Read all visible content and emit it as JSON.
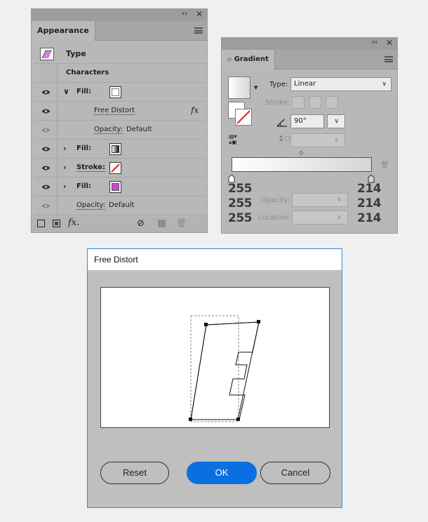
{
  "appearance": {
    "tab_label": "Appearance",
    "header_label": "Type",
    "characters_label": "Characters",
    "rows": [
      {
        "label": "Fill:"
      },
      {
        "label": "Free Distort",
        "fx": "fx"
      },
      {
        "label": "Opacity:",
        "value": "Default"
      },
      {
        "label": "Fill:"
      },
      {
        "label": "Stroke:"
      },
      {
        "label": "Fill:"
      },
      {
        "label": "Opacity:",
        "value": "Default"
      }
    ],
    "bottom_fx": "fx."
  },
  "gradient": {
    "tab_label": "Gradient",
    "type_label": "Type:",
    "type_value": "Linear",
    "stroke_label": "Stroke:",
    "angle_value": "90°",
    "opacity_label": "Opacity:",
    "location_label": "Location:",
    "left_rgb": [
      "255",
      "255",
      "255"
    ],
    "right_rgb": [
      "214",
      "214",
      "214"
    ]
  },
  "dialog": {
    "title": "Free Distort",
    "reset_label": "Reset",
    "ok_label": "OK",
    "cancel_label": "Cancel"
  },
  "colors": {
    "panel_bg": "#b8b8b8",
    "ok_blue": "#0a6fe0",
    "dialog_border": "#3b87d6",
    "magenta_swatch": "#c04fc8",
    "stroke_red": "#e0202a"
  }
}
